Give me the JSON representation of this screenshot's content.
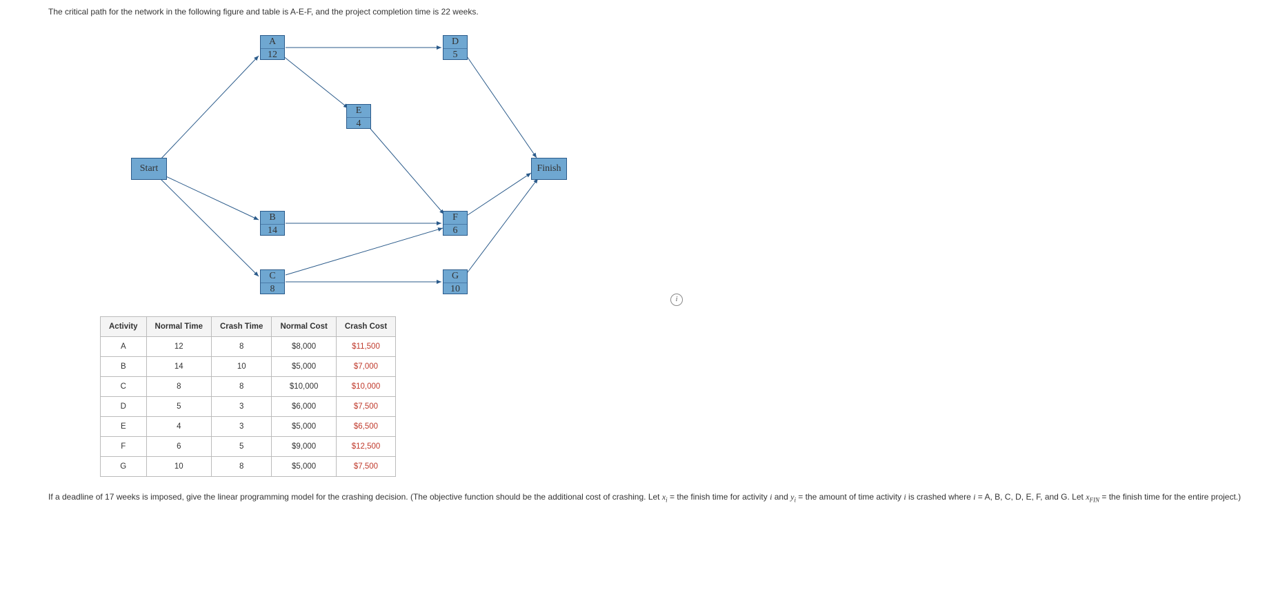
{
  "intro": "The critical path for the network in the following figure and table is A-E-F, and the project completion time is 22 weeks.",
  "nodes": {
    "start": {
      "label": "Start"
    },
    "A": {
      "label": "A",
      "value": "12"
    },
    "B": {
      "label": "B",
      "value": "14"
    },
    "C": {
      "label": "C",
      "value": "8"
    },
    "D": {
      "label": "D",
      "value": "5"
    },
    "E": {
      "label": "E",
      "value": "4"
    },
    "F": {
      "label": "F",
      "value": "6"
    },
    "G": {
      "label": "G",
      "value": "10"
    },
    "finish": {
      "label": "Finish"
    }
  },
  "table": {
    "headers": [
      "Activity",
      "Normal Time",
      "Crash Time",
      "Normal Cost",
      "Crash Cost"
    ],
    "rows": [
      {
        "activity": "A",
        "normal_time": "12",
        "crash_time": "8",
        "normal_cost": "$8,000",
        "crash_cost": "$11,500"
      },
      {
        "activity": "B",
        "normal_time": "14",
        "crash_time": "10",
        "normal_cost": "$5,000",
        "crash_cost": "$7,000"
      },
      {
        "activity": "C",
        "normal_time": "8",
        "crash_time": "8",
        "normal_cost": "$10,000",
        "crash_cost": "$10,000"
      },
      {
        "activity": "D",
        "normal_time": "5",
        "crash_time": "3",
        "normal_cost": "$6,000",
        "crash_cost": "$7,500"
      },
      {
        "activity": "E",
        "normal_time": "4",
        "crash_time": "3",
        "normal_cost": "$5,000",
        "crash_cost": "$6,500"
      },
      {
        "activity": "F",
        "normal_time": "6",
        "crash_time": "5",
        "normal_cost": "$9,000",
        "crash_cost": "$12,500"
      },
      {
        "activity": "G",
        "normal_time": "10",
        "crash_time": "8",
        "normal_cost": "$5,000",
        "crash_cost": "$7,500"
      }
    ]
  },
  "bottom": {
    "part1": "If a deadline of 17 weeks is imposed, give the linear programming model for the crashing decision. (The objective function should be the additional cost of crashing. Let ",
    "xi": "x",
    "part2": " = the finish time for activity ",
    "ivar": "i",
    "part3": " and ",
    "yi": "y",
    "part4": " = the amount of time activity ",
    "part5": " is crashed where ",
    "part6": " = A, B, C, D, E, F, and G. Let ",
    "xfin": "x",
    "fin_sub": "FIN",
    "part7": " = the finish time for the entire project.)"
  },
  "info_icon": "i"
}
